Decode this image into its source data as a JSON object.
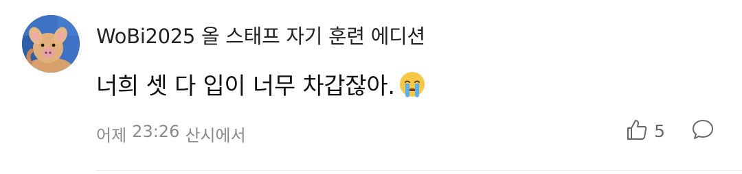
{
  "comment": {
    "author": "WoBi2025 올 스태프 자기 훈련 에디션",
    "text": "너희 셋 다 입이 너무 차갑잖아.",
    "emoji": "crying-face-emoji",
    "timestamp_day": "어제",
    "timestamp_time": "23:26",
    "location": "산시에서",
    "likes": "5"
  },
  "icons": {
    "like": "thumbs-up-icon",
    "reply": "speech-bubble-icon"
  },
  "colors": {
    "author_text": "#222222",
    "body_text": "#111111",
    "meta_text": "#8a8a8a",
    "icon_stroke": "#666666"
  }
}
